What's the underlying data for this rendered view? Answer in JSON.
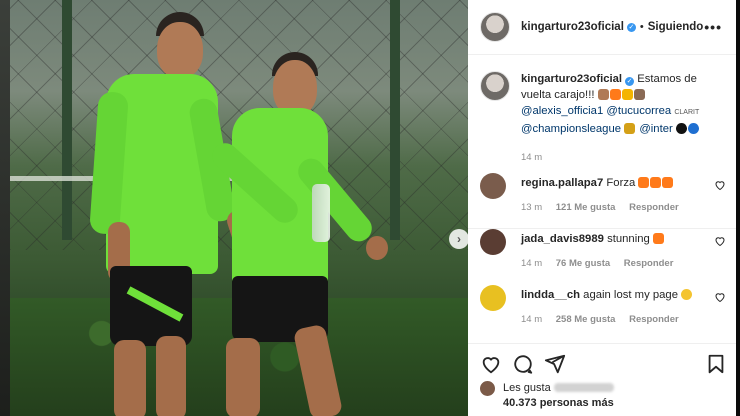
{
  "post": {
    "username": "kingarturo23oficial",
    "separator": "•",
    "follow_status": "Siguiendo",
    "more_icon": "more-options-icon"
  },
  "caption": {
    "username": "kingarturo23oficial",
    "text_line1": "Estamos de",
    "text_line2": "vuelta carajo!!!",
    "mention1": "@alexis_officia1",
    "mention2": "@tucucorrea",
    "clarit": "CLARIT",
    "mention3": "@championsleague",
    "mention4": "@inter",
    "time": "14 m"
  },
  "comments": [
    {
      "user": "regina.pallapa7",
      "text": "Forza",
      "time": "13 m",
      "likes": "121 Me gusta",
      "reply": "Responder",
      "avatar_color": "#7a5c4c"
    },
    {
      "user": "jada_davis8989",
      "text": "stunning",
      "time": "14 m",
      "likes": "76 Me gusta",
      "reply": "Responder",
      "avatar_color": "#5a3d33"
    },
    {
      "user": "lindda__ch",
      "text": "again lost my page",
      "time": "14 m",
      "likes": "258 Me gusta",
      "reply": "Responder",
      "avatar_color": "#e8c021"
    }
  ],
  "likes": {
    "prefix": "Les gusta",
    "count": "40.373 personas más"
  },
  "colors": {
    "jersey": "#6fe03a",
    "verified": "#3897f0",
    "mention": "#00376b",
    "muted": "#8e8e8e"
  }
}
